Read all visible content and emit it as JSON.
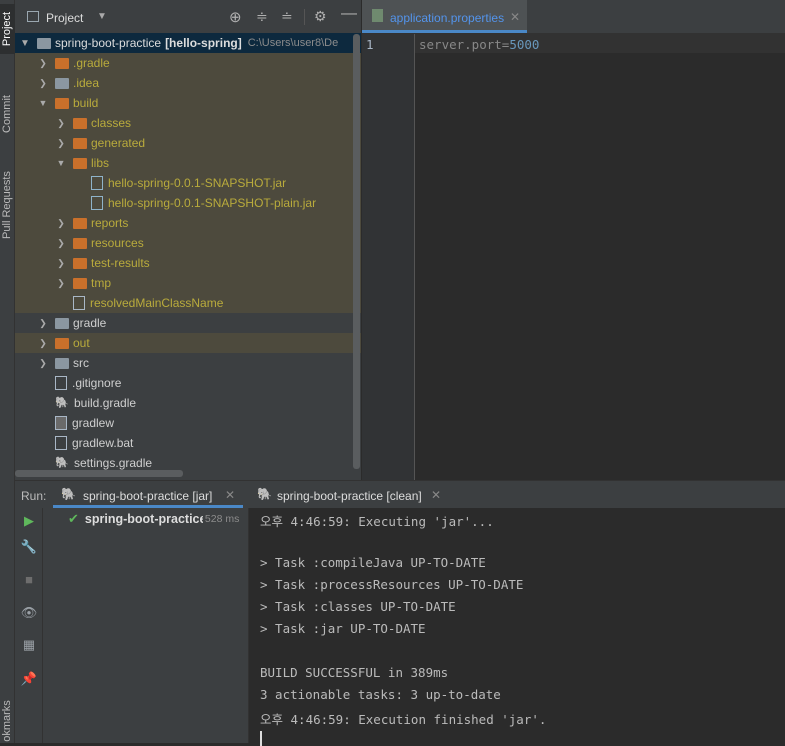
{
  "sidebar": {
    "tabs": [
      "Project",
      "Commit",
      "Pull Requests",
      "okmarks"
    ]
  },
  "project": {
    "title": "Project",
    "root_name": "spring-boot-practice",
    "root_module": "[hello-spring]",
    "root_path": "C:\\Users\\user8\\De",
    "tree": [
      {
        "label": ".gradle",
        "indent": 1,
        "arrow": "right",
        "icon": "folder-orange",
        "color": "yellow",
        "excluded": true
      },
      {
        "label": ".idea",
        "indent": 1,
        "arrow": "right",
        "icon": "folder-gray",
        "color": "yellow",
        "excluded": true
      },
      {
        "label": "build",
        "indent": 1,
        "arrow": "down",
        "icon": "folder-orange",
        "color": "yellow",
        "excluded": true
      },
      {
        "label": "classes",
        "indent": 2,
        "arrow": "right",
        "icon": "folder-orange",
        "color": "yellow",
        "excluded": true
      },
      {
        "label": "generated",
        "indent": 2,
        "arrow": "right",
        "icon": "folder-orange",
        "color": "yellow",
        "excluded": true
      },
      {
        "label": "libs",
        "indent": 2,
        "arrow": "down",
        "icon": "folder-orange",
        "color": "yellow",
        "excluded": true
      },
      {
        "label": "hello-spring-0.0.1-SNAPSHOT.jar",
        "indent": 3,
        "arrow": "",
        "icon": "jar-file",
        "color": "yellow",
        "excluded": true
      },
      {
        "label": "hello-spring-0.0.1-SNAPSHOT-plain.jar",
        "indent": 3,
        "arrow": "",
        "icon": "jar-file",
        "color": "yellow",
        "excluded": true
      },
      {
        "label": "reports",
        "indent": 2,
        "arrow": "right",
        "icon": "folder-orange",
        "color": "yellow",
        "excluded": true
      },
      {
        "label": "resources",
        "indent": 2,
        "arrow": "right",
        "icon": "folder-orange",
        "color": "yellow",
        "excluded": true
      },
      {
        "label": "test-results",
        "indent": 2,
        "arrow": "right",
        "icon": "folder-orange",
        "color": "yellow",
        "excluded": true
      },
      {
        "label": "tmp",
        "indent": 2,
        "arrow": "right",
        "icon": "folder-orange",
        "color": "yellow",
        "excluded": true
      },
      {
        "label": "resolvedMainClassName",
        "indent": 2,
        "arrow": "",
        "icon": "text-file",
        "color": "yellow",
        "excluded": true
      },
      {
        "label": "gradle",
        "indent": 1,
        "arrow": "right",
        "icon": "folder-gray",
        "color": "normal",
        "excluded": false
      },
      {
        "label": "out",
        "indent": 1,
        "arrow": "right",
        "icon": "folder-orange",
        "color": "yellow",
        "excluded": true
      },
      {
        "label": "src",
        "indent": 1,
        "arrow": "right",
        "icon": "folder-gray",
        "color": "normal",
        "excluded": false
      },
      {
        "label": ".gitignore",
        "indent": 1,
        "arrow": "",
        "icon": "gitignore-file",
        "color": "normal",
        "excluded": false
      },
      {
        "label": "build.gradle",
        "indent": 1,
        "arrow": "",
        "icon": "gradle-file",
        "color": "normal",
        "excluded": false
      },
      {
        "label": "gradlew",
        "indent": 1,
        "arrow": "",
        "icon": "script-file",
        "color": "normal",
        "excluded": false
      },
      {
        "label": "gradlew.bat",
        "indent": 1,
        "arrow": "",
        "icon": "text-file",
        "color": "normal",
        "excluded": false
      },
      {
        "label": "settings.gradle",
        "indent": 1,
        "arrow": "",
        "icon": "gradle-file",
        "color": "normal",
        "excluded": false
      }
    ]
  },
  "editor": {
    "tab_label": "application.properties",
    "line_number": "1",
    "code_key": "server.port=",
    "code_value": "5000"
  },
  "run": {
    "label": "Run:",
    "tabs": [
      {
        "label": "spring-boot-practice [jar]",
        "active": true
      },
      {
        "label": "spring-boot-practice [clean]",
        "active": false
      }
    ],
    "tree_item": "spring-boot-practice",
    "tree_time": "528 ms",
    "console_lines": [
      "오후 4:46:59: Executing 'jar'...",
      "",
      "> Task :compileJava UP-TO-DATE",
      "> Task :processResources UP-TO-DATE",
      "> Task :classes UP-TO-DATE",
      "> Task :jar UP-TO-DATE",
      "",
      "BUILD SUCCESSFUL in 389ms",
      "3 actionable tasks: 3 up-to-date",
      "오후 4:46:59: Execution finished 'jar'."
    ]
  },
  "colors": {
    "folder_orange": "#c9702b",
    "folder_gray": "#8b97a1",
    "excluded_text": "#b9ab3c",
    "success": "#5fb85c",
    "link_tab": "#5394ec",
    "number": "#6897bb"
  }
}
